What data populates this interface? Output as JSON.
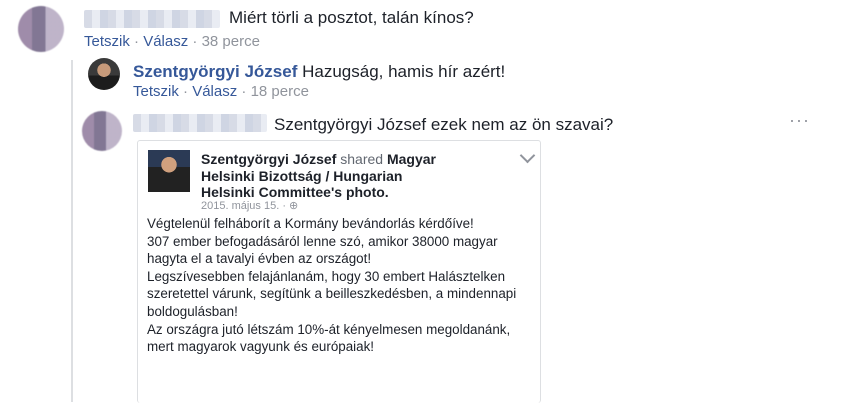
{
  "comment1": {
    "text": "Miért törli a posztot, talán kínos?",
    "like": "Tetszik",
    "reply": "Válasz",
    "sep": "·",
    "time": "38 perce"
  },
  "reply1": {
    "author": "Szentgyörgyi József",
    "text": "Hazugság, hamis hír azért!",
    "like": "Tetszik",
    "reply": "Válasz",
    "sep": "·",
    "time": "18 perce"
  },
  "reply2": {
    "text": "Szentgyörgyi József ezek nem az ön szavai?",
    "more": "···"
  },
  "shared": {
    "author": "Szentgyörgyi József",
    "shared_word": "shared",
    "page_line1": "Magyar",
    "page_line2": "Helsinki Bizottság / Hungarian",
    "page_line3": "Helsinki Committee",
    "photo_suffix": "'s photo.",
    "date": "2015. május 15. · ⊕",
    "body": "Végtelenül felháborít a Kormány bevándorlás kérdőíve!\n307 ember befogadásáról lenne szó, amikor 38000 magyar hagyta el a tavalyi évben az országot!\nLegszívesebben felajánlanám, hogy 30 embert Halásztelken szeretettel várunk, segítünk a beilleszkedésben, a mindennapi boldogulásban!\nAz országra jutó létszám 10%-át kényelmesen megoldanánk, mert magyarok vagyunk és európaiak!"
  }
}
